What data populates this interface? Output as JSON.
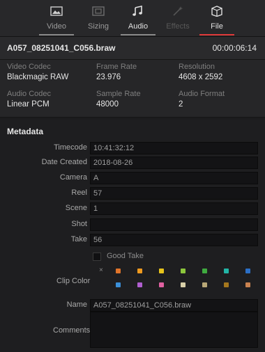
{
  "tabs": [
    {
      "label": "Video",
      "icon": "video-icon"
    },
    {
      "label": "Sizing",
      "icon": "sizing-icon"
    },
    {
      "label": "Audio",
      "icon": "audio-icon"
    },
    {
      "label": "Effects",
      "icon": "effects-icon"
    },
    {
      "label": "File",
      "icon": "file-icon"
    }
  ],
  "clip": {
    "name": "A057_08251041_C056.braw",
    "timecode": "00:00:06:14"
  },
  "info": {
    "video_codec_label": "Video Codec",
    "video_codec": "Blackmagic RAW",
    "frame_rate_label": "Frame Rate",
    "frame_rate": "23.976",
    "resolution_label": "Resolution",
    "resolution": "4608 x 2592",
    "audio_codec_label": "Audio Codec",
    "audio_codec": "Linear PCM",
    "sample_rate_label": "Sample Rate",
    "sample_rate": "48000",
    "audio_format_label": "Audio Format",
    "audio_format": "2"
  },
  "metadata": {
    "title": "Metadata",
    "fields": {
      "timecode": {
        "label": "Timecode",
        "value": "10:41:32:12"
      },
      "date_created": {
        "label": "Date Created",
        "value": "2018-08-26"
      },
      "camera": {
        "label": "Camera",
        "value": "A"
      },
      "reel": {
        "label": "Reel",
        "value": "57"
      },
      "scene": {
        "label": "Scene",
        "value": "1"
      },
      "shot": {
        "label": "Shot",
        "value": ""
      },
      "take": {
        "label": "Take",
        "value": "56"
      },
      "name": {
        "label": "Name",
        "value": "A057_08251041_C056.braw"
      },
      "comments": {
        "label": "Comments",
        "value": ""
      }
    },
    "good_take": "Good Take",
    "clip_color_label": "Clip Color",
    "clip_colors": [
      "#e0742a",
      "#ef9a1f",
      "#e7c31b",
      "#8cc63c",
      "#3faa3f",
      "#22b5a6",
      "#2b6fc6",
      "#3b8fd9",
      "#b05fd0",
      "#e061a1",
      "#d8cfa8",
      "#b8a777",
      "#a4771d",
      "#c98250"
    ]
  }
}
